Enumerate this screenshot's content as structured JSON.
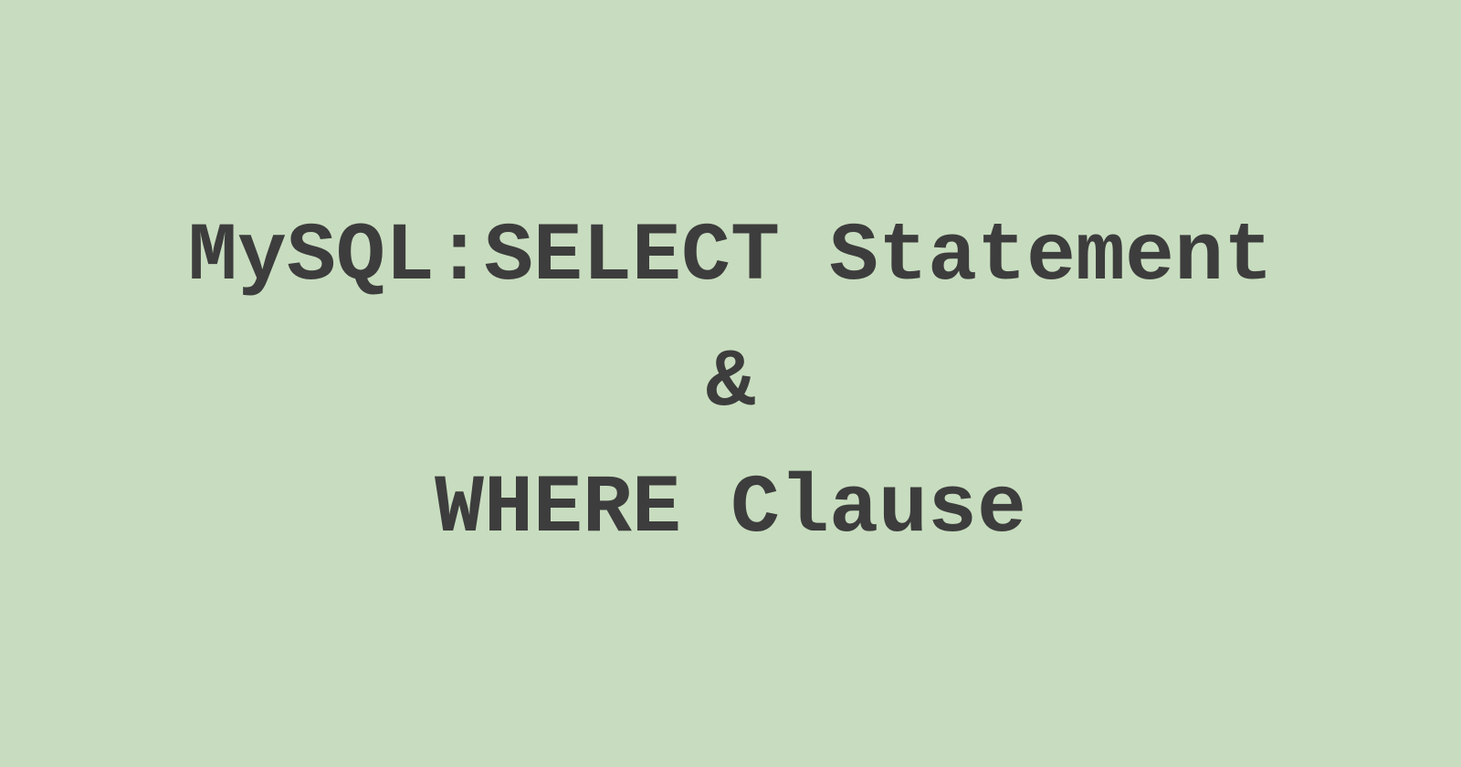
{
  "title": {
    "line1": "MySQL:SELECT Statement",
    "line2": "&",
    "line3": "WHERE Clause"
  },
  "colors": {
    "background": "#c8ddbf",
    "text": "#3d3d3d"
  }
}
